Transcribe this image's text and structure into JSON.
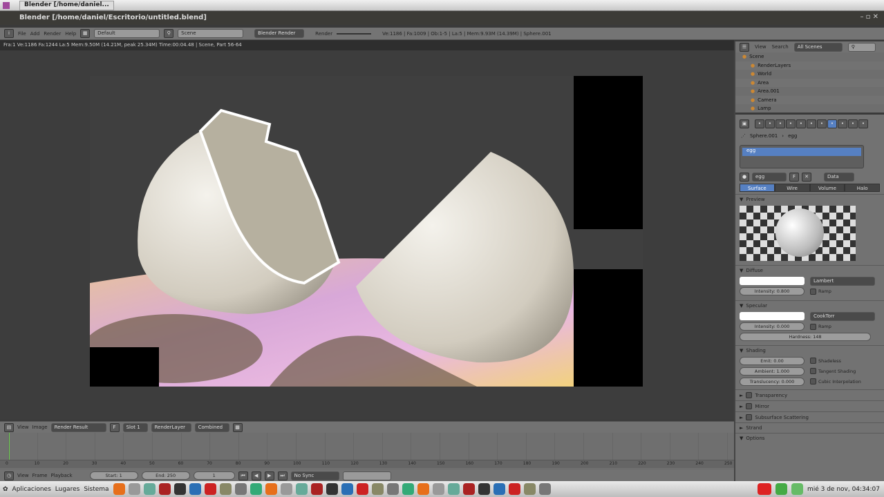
{
  "os_topbar": {
    "tab_title": "Blender [/home/daniel..."
  },
  "window": {
    "title": "Blender [/home/daniel/Escritorio/untitled.blend]"
  },
  "main_header": {
    "menus": [
      "File",
      "Add",
      "Render",
      "Help"
    ],
    "layout": "Default",
    "scene": "Scene",
    "engine": "Blender Render",
    "render_label": "Render",
    "stats": "Ve:1186 | Fa:1009 | Ob:1-5 | La:5 | Mem:9.93M (14.39M) | Sphere.001"
  },
  "info_line": "Fra:1  Ve:1186 Fa:1244 La:5 Mem:9.50M (14.21M, peak 25.34M) Time:00:04.48 | Scene, Part 56-64",
  "image_header": {
    "menus": [
      "View",
      "Image"
    ],
    "image": "Render Result",
    "f_label": "F",
    "slot": "Slot 1",
    "layer": "RenderLayer",
    "pass": "Combined"
  },
  "timeline": {
    "ticks": [
      0,
      10,
      20,
      30,
      40,
      50,
      60,
      70,
      80,
      90,
      100,
      110,
      120,
      130,
      140,
      150,
      160,
      170,
      180,
      190,
      200,
      210,
      220,
      230,
      240,
      250
    ],
    "current_frame": 1
  },
  "timeline_header": {
    "menus": [
      "View",
      "Frame",
      "Playback"
    ],
    "start": "Start: 1",
    "end": "End: 250",
    "frame": "1",
    "sync": "No Sync"
  },
  "outliner": {
    "menus": [
      "View",
      "Search"
    ],
    "filter": "All Scenes",
    "items": [
      "Scene",
      "RenderLayers",
      "World",
      "Area",
      "Area.001",
      "Camera",
      "Lamp"
    ]
  },
  "properties": {
    "breadcrumb": [
      "Sphere.001",
      "egg"
    ],
    "material_slot": "egg",
    "material_name": "egg",
    "f_label": "F",
    "data_select": "Data",
    "tabs": [
      "Surface",
      "Wire",
      "Volume",
      "Halo"
    ],
    "active_tab": "Surface",
    "preview_label": "Preview",
    "diffuse": {
      "label": "Diffuse",
      "shader": "Lambert",
      "intensity": "Intensity: 0.800",
      "ramp": "Ramp",
      "color": "#ffffff"
    },
    "specular": {
      "label": "Specular",
      "shader": "CookTorr",
      "intensity": "Intensity: 0.000",
      "ramp": "Ramp",
      "hardness": "Hardness: 148"
    },
    "shading": {
      "label": "Shading",
      "emit": "Emit: 0.00",
      "ambient": "Ambient: 1.000",
      "translucency": "Translucency: 0.000",
      "shadeless": "Shadeless",
      "tangent": "Tangent Shading",
      "cubic": "Cubic Interpolation"
    },
    "collapsed": [
      "Transparency",
      "Mirror",
      "Subsurface Scattering",
      "Strand"
    ],
    "options": "Options"
  },
  "taskbar": {
    "menus": [
      "Aplicaciones",
      "Lugares",
      "Sistema"
    ],
    "clock": "mié 3 de nov, 04:34:07"
  },
  "colors": {
    "accent": "#5680c2",
    "header": "#727272",
    "viewport": "#3d3d3d"
  }
}
